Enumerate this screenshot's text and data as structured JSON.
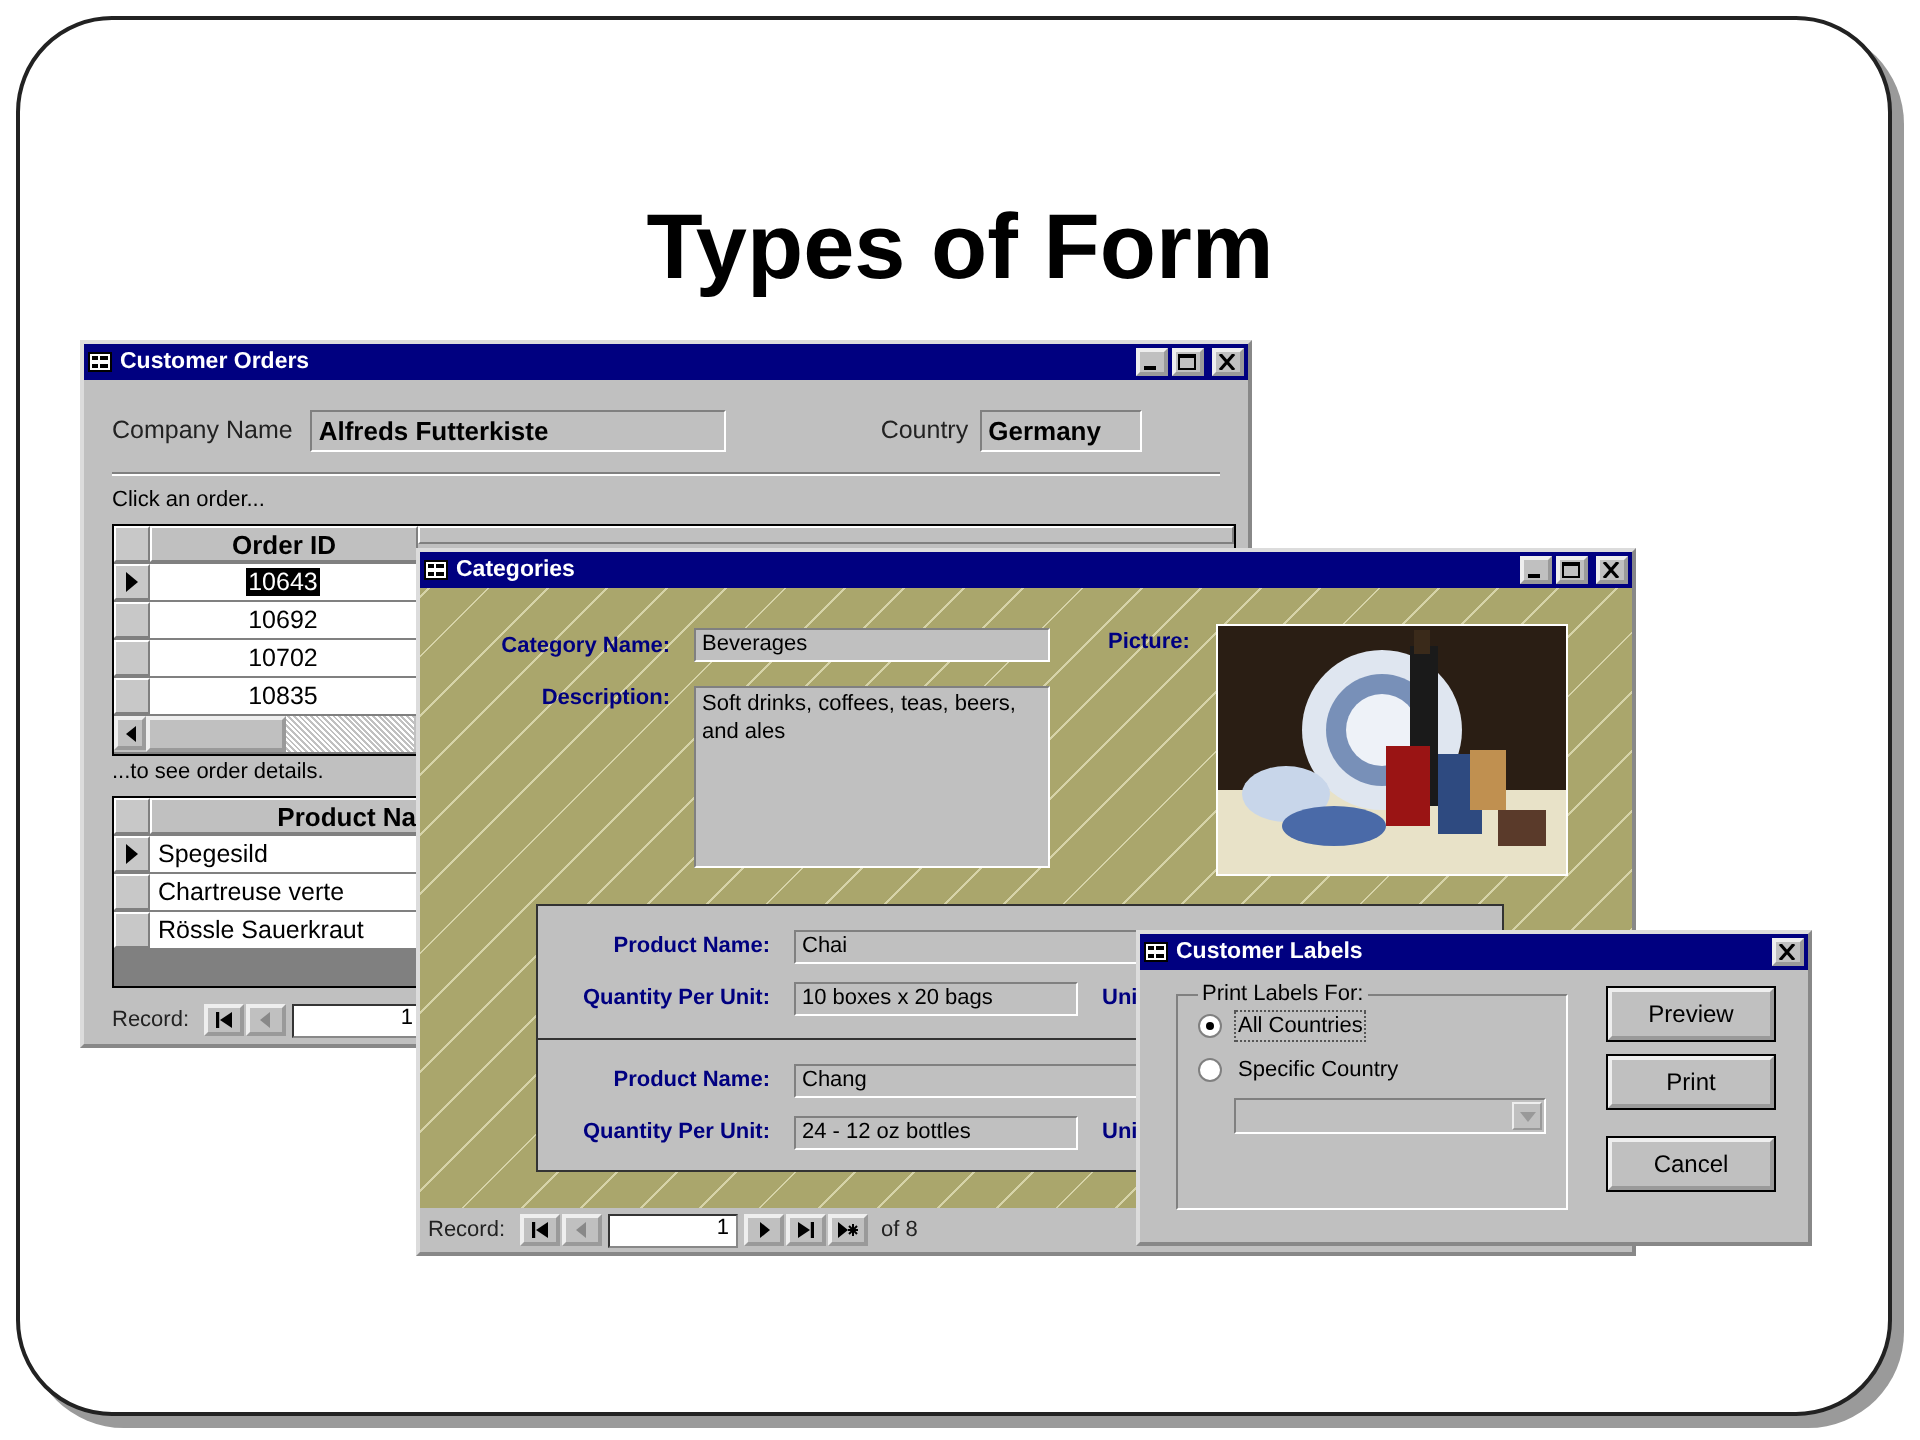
{
  "slide": {
    "title": "Types of Form"
  },
  "customer_orders": {
    "title": "Customer Orders",
    "company_label": "Company Name",
    "company": "Alfreds Futterkiste",
    "country_label": "Country",
    "country": "Germany",
    "hint": "Click an order...",
    "orders_column": "Order ID",
    "orders": [
      {
        "id": "10643",
        "selected": true
      },
      {
        "id": "10692",
        "selected": false
      },
      {
        "id": "10702",
        "selected": false
      },
      {
        "id": "10835",
        "selected": false
      }
    ],
    "details_hint": "...to see order details.",
    "products_column": "Product Na",
    "products": [
      {
        "name": "Spegesild",
        "selected": true
      },
      {
        "name": "Chartreuse verte",
        "selected": false
      },
      {
        "name": "Rössle Sauerkraut",
        "selected": false
      }
    ],
    "record_label": "Record:",
    "record": "1"
  },
  "categories": {
    "title": "Categories",
    "category_label": "Category Name:",
    "category": "Beverages",
    "description_label": "Description:",
    "description": "Soft drinks, coffees, teas, beers, and ales",
    "picture_label": "Picture:",
    "products": [
      {
        "name_label": "Product Name:",
        "name": "Chai",
        "qty_label": "Quantity Per Unit:",
        "qty": "10 boxes x 20 bags",
        "unit_label": "Uni"
      },
      {
        "name_label": "Product Name:",
        "name": "Chang",
        "qty_label": "Quantity Per Unit:",
        "qty": "24 - 12 oz bottles",
        "unit_label": "Uni"
      }
    ],
    "record_label": "Record:",
    "record": "1",
    "of": "of",
    "count": "8"
  },
  "customer_labels": {
    "title": "Customer Labels",
    "group_label": "Print Labels For:",
    "options": [
      {
        "label": "All Countries",
        "selected": true
      },
      {
        "label": "Specific Country",
        "selected": false
      }
    ],
    "buttons": [
      "Preview",
      "Print",
      "Cancel"
    ]
  }
}
